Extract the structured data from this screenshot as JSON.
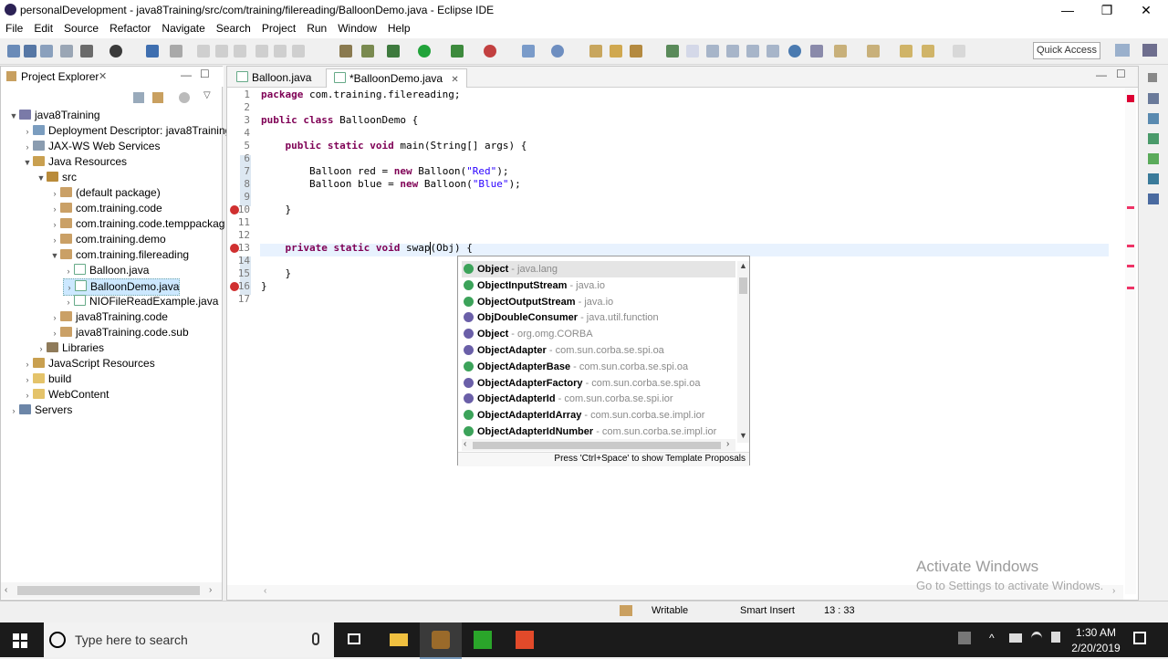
{
  "window": {
    "title": "personalDevelopment - java8Training/src/com/training/filereading/BalloonDemo.java - Eclipse IDE",
    "minimize": "—",
    "restore": "❐",
    "close": "✕"
  },
  "menu": [
    "File",
    "Edit",
    "Source",
    "Refactor",
    "Navigate",
    "Search",
    "Project",
    "Run",
    "Window",
    "Help"
  ],
  "toolbar": {
    "quick_access_label": "Quick Access"
  },
  "project_explorer": {
    "title": "Project Explorer",
    "close": "✕",
    "tree": [
      {
        "label": "java8Training",
        "depth": 0,
        "twisty": "▼",
        "icon": "project-icon"
      },
      {
        "label": "Deployment Descriptor: java8Training",
        "depth": 1,
        "twisty": "›",
        "icon": "descriptor-icon"
      },
      {
        "label": "JAX-WS Web Services",
        "depth": 1,
        "twisty": "›",
        "icon": "webservices-icon"
      },
      {
        "label": "Java Resources",
        "depth": 1,
        "twisty": "▼",
        "icon": "java-resources-icon"
      },
      {
        "label": "src",
        "depth": 2,
        "twisty": "▼",
        "icon": "source-folder-icon"
      },
      {
        "label": "(default package)",
        "depth": 3,
        "twisty": "›",
        "icon": "package-icon"
      },
      {
        "label": "com.training.code",
        "depth": 3,
        "twisty": "›",
        "icon": "package-icon"
      },
      {
        "label": "com.training.code.temppackag",
        "depth": 3,
        "twisty": "›",
        "icon": "package-icon"
      },
      {
        "label": "com.training.demo",
        "depth": 3,
        "twisty": "›",
        "icon": "package-icon"
      },
      {
        "label": "com.training.filereading",
        "depth": 3,
        "twisty": "▼",
        "icon": "package-icon"
      },
      {
        "label": "Balloon.java",
        "depth": 4,
        "twisty": "›",
        "icon": "java-file-icon"
      },
      {
        "label": "BalloonDemo.java",
        "depth": 4,
        "twisty": "›",
        "icon": "java-file-icon",
        "selected": true
      },
      {
        "label": "NIOFileReadExample.java",
        "depth": 4,
        "twisty": "›",
        "icon": "java-file-icon"
      },
      {
        "label": "java8Training.code",
        "depth": 3,
        "twisty": "›",
        "icon": "package-icon"
      },
      {
        "label": "java8Training.code.sub",
        "depth": 3,
        "twisty": "›",
        "icon": "package-icon"
      },
      {
        "label": "Libraries",
        "depth": 2,
        "twisty": "›",
        "icon": "libraries-icon"
      },
      {
        "label": "JavaScript Resources",
        "depth": 1,
        "twisty": "›",
        "icon": "js-resources-icon"
      },
      {
        "label": "build",
        "depth": 1,
        "twisty": "›",
        "icon": "folder-icon"
      },
      {
        "label": "WebContent",
        "depth": 1,
        "twisty": "›",
        "icon": "folder-icon"
      },
      {
        "label": "Servers",
        "depth": 0,
        "twisty": "›",
        "icon": "servers-icon"
      }
    ]
  },
  "editor": {
    "tabs": [
      {
        "label": "Balloon.java",
        "active": false
      },
      {
        "label": "*BalloonDemo.java",
        "active": true,
        "close": "✕"
      }
    ],
    "lines": [
      {
        "n": "1",
        "html": "<span class=\"kw\">package</span> com.training.filereading;"
      },
      {
        "n": "2",
        "html": ""
      },
      {
        "n": "3",
        "html": "<span class=\"kw\">public class</span> BalloonDemo {"
      },
      {
        "n": "4",
        "html": ""
      },
      {
        "n": "5",
        "html": "    <span class=\"kw\">public static void</span> main(String[] args) {"
      },
      {
        "n": "6",
        "html": ""
      },
      {
        "n": "7",
        "html": "        Balloon red = <span class=\"kw\">new</span> Balloon(<span class=\"str\">\"Red\"</span>);"
      },
      {
        "n": "8",
        "html": "        Balloon blue = <span class=\"kw\">new</span> Balloon(<span class=\"str\">\"Blue\"</span>);"
      },
      {
        "n": "9",
        "html": ""
      },
      {
        "n": "10",
        "html": "    }"
      },
      {
        "n": "11",
        "html": ""
      },
      {
        "n": "12",
        "html": ""
      },
      {
        "n": "13",
        "html": "    <span class=\"kw\">private static void</span> swap(Obj) {"
      },
      {
        "n": "14",
        "html": ""
      },
      {
        "n": "15",
        "html": "    }"
      },
      {
        "n": "16",
        "html": "}"
      },
      {
        "n": "17",
        "html": ""
      }
    ]
  },
  "content_assist": {
    "proposals": [
      {
        "name": "Object",
        "qual": " - java.lang",
        "kind": "class",
        "selected": true
      },
      {
        "name": "ObjectInputStream",
        "qual": " - java.io",
        "kind": "class"
      },
      {
        "name": "ObjectOutputStream",
        "qual": " - java.io",
        "kind": "class"
      },
      {
        "name": "ObjDoubleConsumer",
        "qual": " - java.util.function",
        "kind": "interface"
      },
      {
        "name": "Object",
        "qual": " - org.omg.CORBA",
        "kind": "interface"
      },
      {
        "name": "ObjectAdapter",
        "qual": " - com.sun.corba.se.spi.oa",
        "kind": "interface"
      },
      {
        "name": "ObjectAdapterBase",
        "qual": " - com.sun.corba.se.spi.oa",
        "kind": "class"
      },
      {
        "name": "ObjectAdapterFactory",
        "qual": " - com.sun.corba.se.spi.oa",
        "kind": "interface"
      },
      {
        "name": "ObjectAdapterId",
        "qual": " - com.sun.corba.se.spi.ior",
        "kind": "interface"
      },
      {
        "name": "ObjectAdapterIdArray",
        "qual": " - com.sun.corba.se.impl.ior",
        "kind": "class"
      },
      {
        "name": "ObjectAdapterIdNumber",
        "qual": " - com.sun.corba.se.impl.ior",
        "kind": "class"
      }
    ],
    "footer": "Press 'Ctrl+Space' to show Template Proposals"
  },
  "status": {
    "writable": "Writable",
    "insert_mode": "Smart Insert",
    "position": "13 : 33"
  },
  "watermark": {
    "line1": "Activate Windows",
    "line2": "Go to Settings to activate Windows."
  },
  "taskbar": {
    "search_placeholder": "Type here to search",
    "time": "1:30 AM",
    "date": "2/20/2019"
  }
}
